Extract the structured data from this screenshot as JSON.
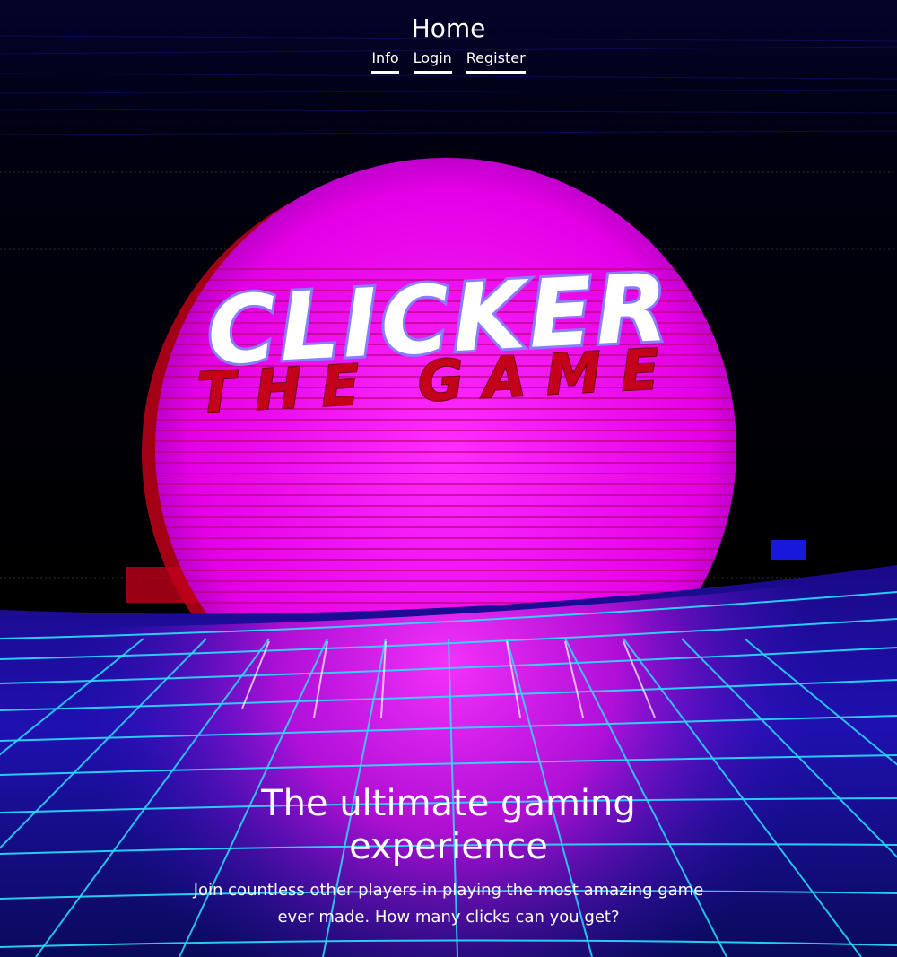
{
  "header": {
    "title": "Home",
    "nav": [
      {
        "label": "Info"
      },
      {
        "label": "Login"
      },
      {
        "label": "Register"
      }
    ]
  },
  "logo": {
    "line1": "CLICKER",
    "line2": "THE GAME"
  },
  "hero": {
    "title": "The ultimate gaming experience",
    "subtitle": "Join countless other players in playing the most amazing game ever made. How many clicks can you get?"
  },
  "colors": {
    "sun": "#ff00ff",
    "grid": "#29e0ff",
    "background": "#000000",
    "logo_outline": "#8a7cff",
    "logo_subtitle": "#c4001a"
  }
}
